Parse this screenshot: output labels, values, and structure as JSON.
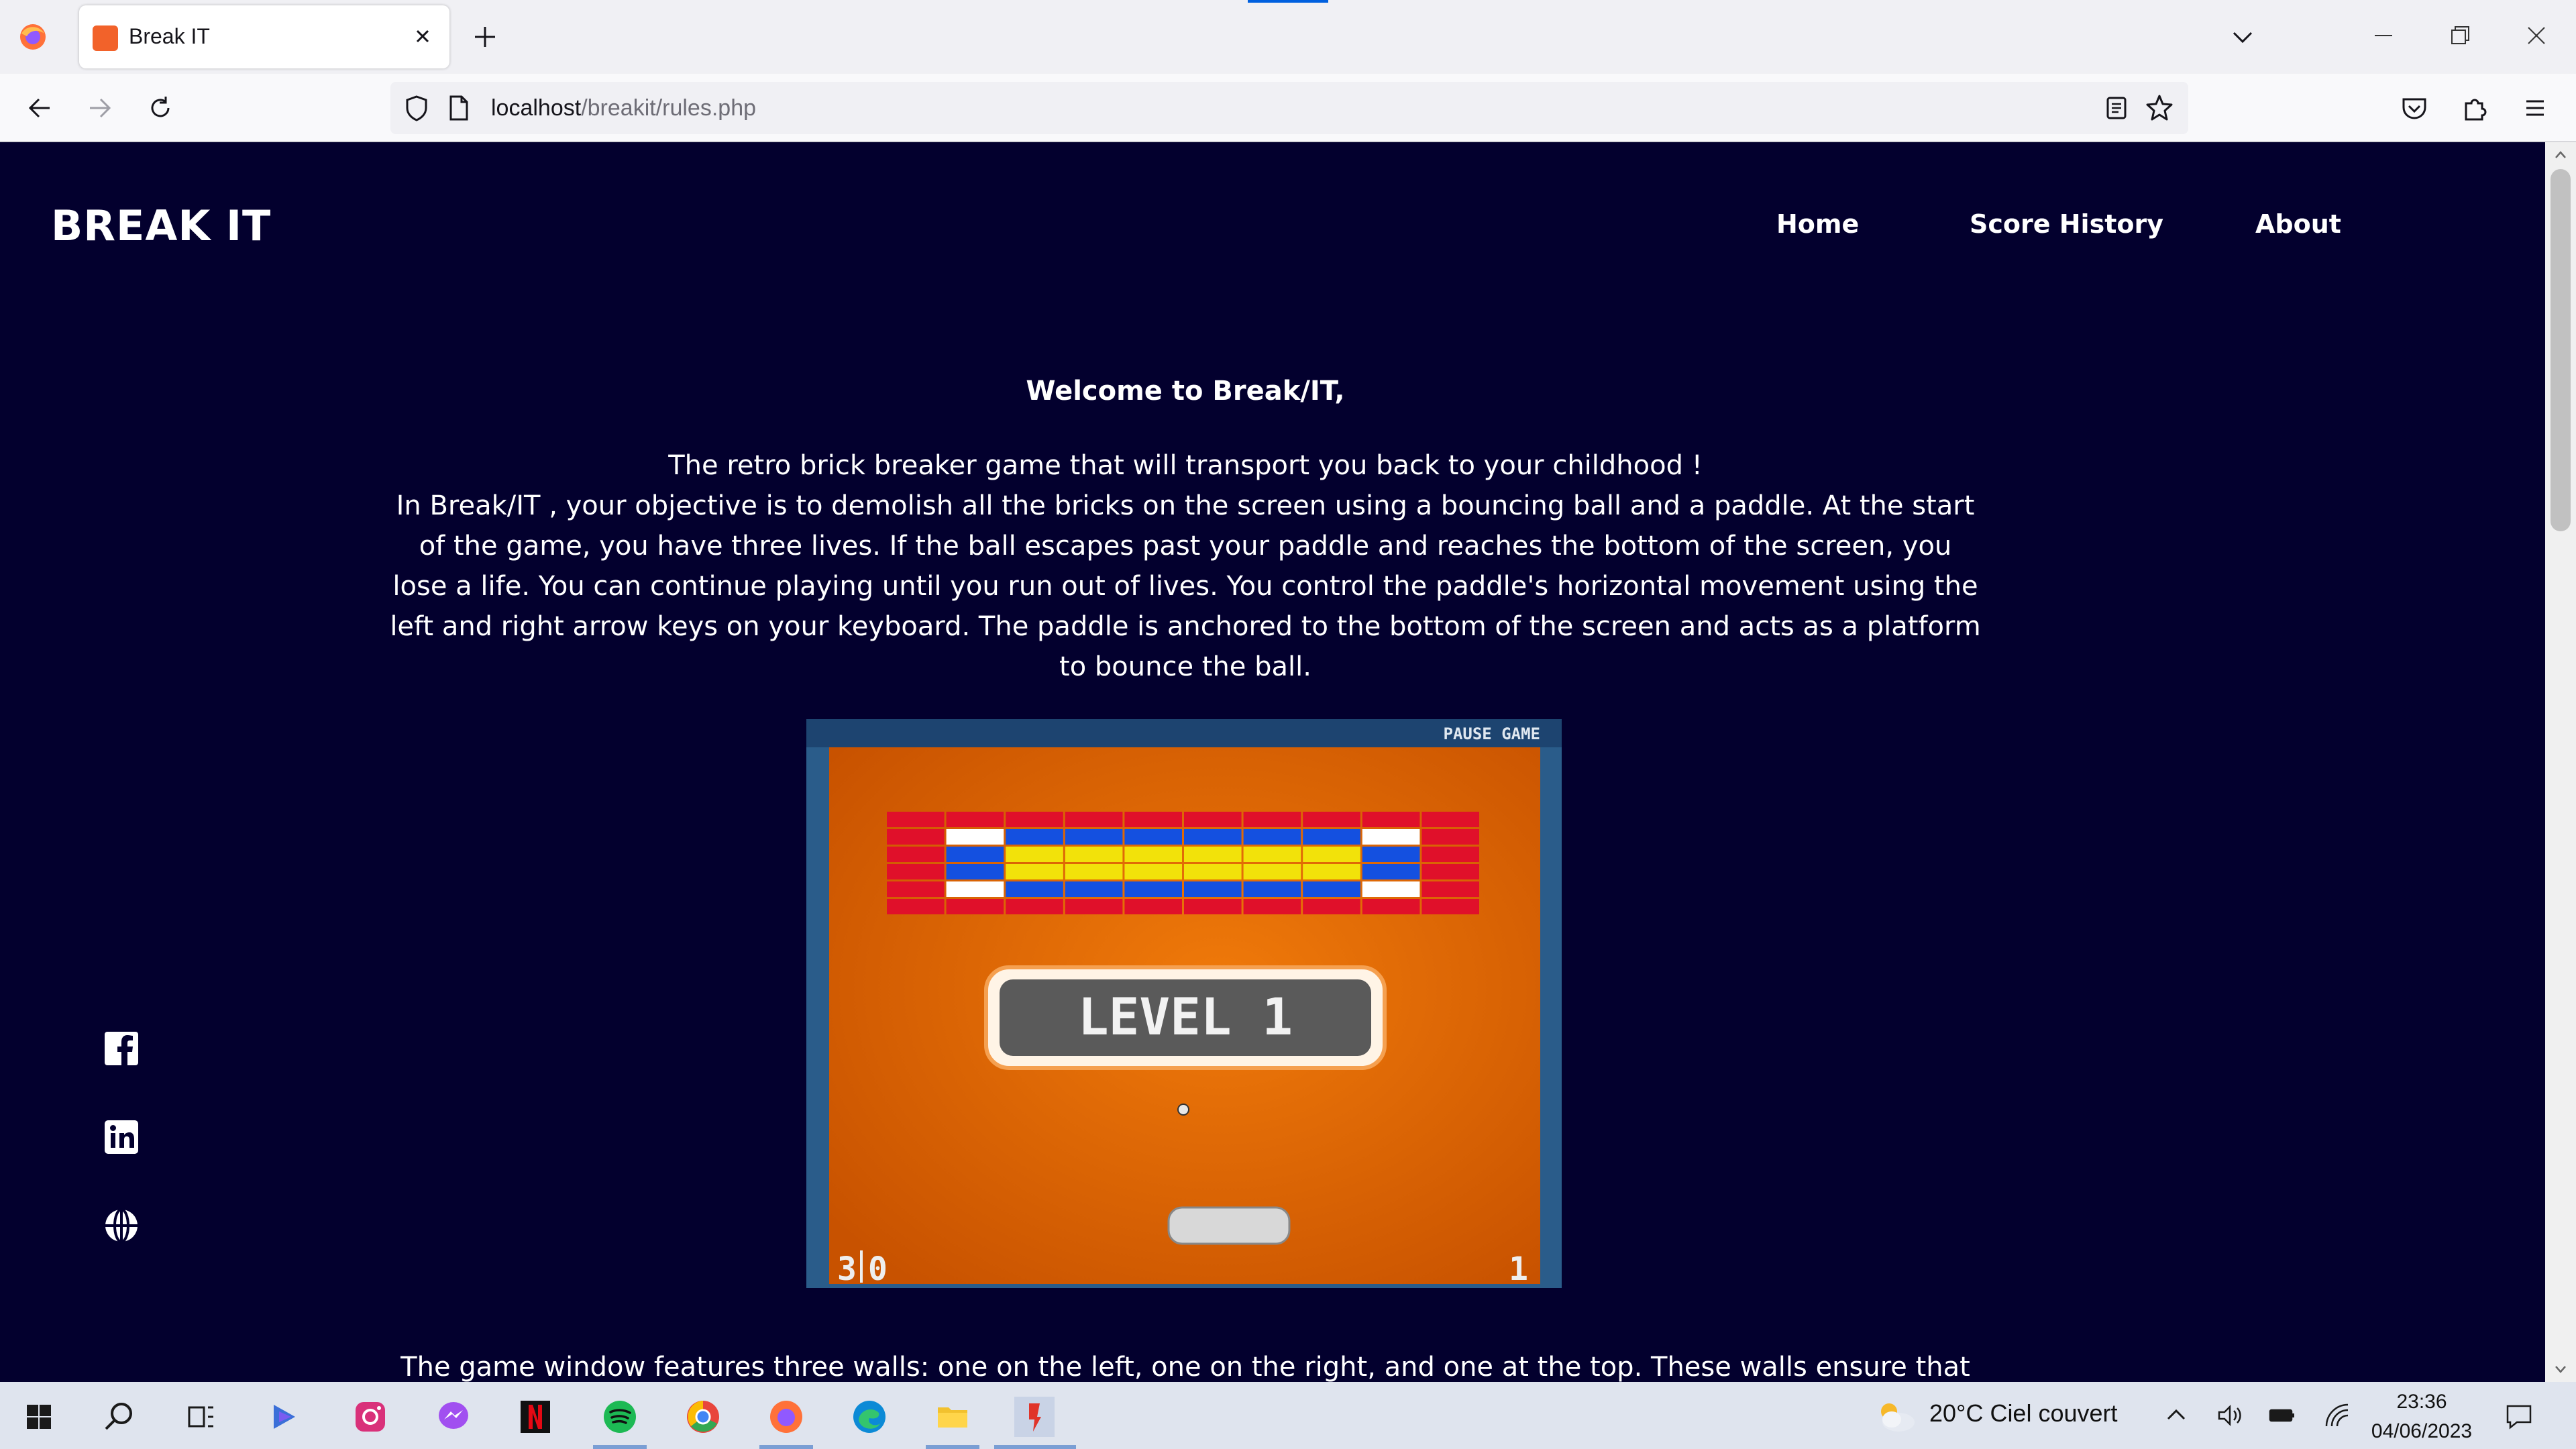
{
  "browser": {
    "tab_title": "Break IT",
    "url_host": "localhost",
    "url_path": "/breakit/rules.php"
  },
  "site": {
    "brand": "BREAK IT",
    "nav": [
      "Home",
      "Score History",
      "About"
    ]
  },
  "content": {
    "welcome": "Welcome to Break/IT,",
    "intro_line1": "The retro brick breaker game that will transport you back to your childhood !",
    "intro_body": "In Break/IT , your objective is to demolish all the bricks on the screen using a bouncing ball and a paddle. At the start of the game, you have three lives. If the ball escapes past your paddle and reaches the bottom of the screen, you lose a life. You can continue playing until you run out of lives. You control the paddle's horizontal movement using the left and right arrow keys on your keyboard. The paddle is anchored to the bottom of the screen and acts as a platform to bounce the ball.",
    "bottom_text": "The game window features three walls: one on the left, one on the right, and one at the top. These walls ensure that the"
  },
  "game_screenshot": {
    "pause_label": "PAUSE GAME",
    "level_label": "LEVEL 1",
    "lives": "3",
    "score": "0",
    "stage": "1"
  },
  "social_icons": [
    "facebook-icon",
    "linkedin-icon",
    "globe-icon"
  ],
  "taskbar": {
    "weather": "20°C  Ciel couvert",
    "time": "23:36",
    "date": "04/06/2023"
  },
  "colors": {
    "page_bg": "#03002e",
    "game_orange": "#e86c00",
    "brick_red": "#e0102a",
    "brick_blue": "#1450e0",
    "brick_yellow": "#f2e20a"
  }
}
